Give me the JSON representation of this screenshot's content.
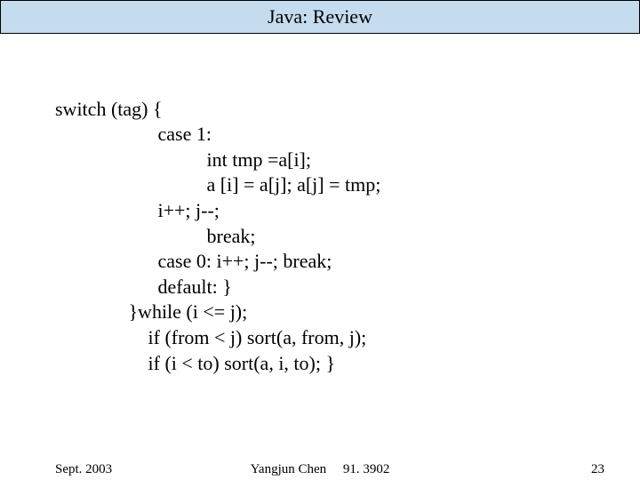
{
  "title": "Java: Review",
  "code": {
    "l1": "switch (tag) {",
    "l2": "                     case 1:",
    "l3": "                               int tmp =a[i];",
    "l4": "                               a [i] = a[j]; a[j] = tmp;",
    "l5": "                     i++; j--;",
    "l6": "                               break;",
    "l7": "                     case 0: i++; j--; break;",
    "l8": "                     default: }",
    "l9": "               }while (i <= j);",
    "l10": "                   if (from < j) sort(a, from, j);",
    "l11": "                   if (i < to) sort(a, i, to); }"
  },
  "footer": {
    "date": "Sept. 2003",
    "author": "Yangjun Chen",
    "course": "91. 3902",
    "page": "23"
  }
}
